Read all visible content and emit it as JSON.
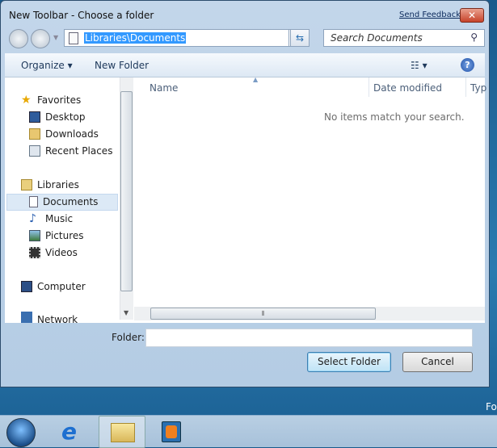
{
  "window": {
    "title": "New Toolbar - Choose a folder",
    "send_feedback": "Send Feedback",
    "close": "✕"
  },
  "address": {
    "value": "Libraries\\Documents"
  },
  "search": {
    "placeholder": "Search Documents"
  },
  "toolbar": {
    "organize": "Organize ▾",
    "new_folder": "New Folder",
    "views": "☷ ▾",
    "help": "?"
  },
  "sidebar": {
    "items": [
      {
        "label": "Favorites",
        "icon": "star-icon"
      },
      {
        "label": "Desktop",
        "icon": "desktop-icon"
      },
      {
        "label": "Downloads",
        "icon": "downloads-icon"
      },
      {
        "label": "Recent Places",
        "icon": "recent-places-icon"
      },
      {
        "label": "Libraries",
        "icon": "libraries-icon"
      },
      {
        "label": "Documents",
        "icon": "document-icon"
      },
      {
        "label": "Music",
        "icon": "music-icon"
      },
      {
        "label": "Pictures",
        "icon": "pictures-icon"
      },
      {
        "label": "Videos",
        "icon": "videos-icon"
      },
      {
        "label": "Computer",
        "icon": "computer-icon"
      },
      {
        "label": "Network",
        "icon": "network-icon"
      }
    ]
  },
  "columns": [
    "Name",
    "Date modified",
    "Typ"
  ],
  "empty_message": "No items match your search.",
  "folder": {
    "label": "Folder:",
    "value": ""
  },
  "buttons": {
    "select": "Select Folder",
    "cancel": "Cancel"
  },
  "desktop_text": "Fo",
  "colors": {
    "selection": "#3399ff",
    "accent": "#1e395b"
  }
}
